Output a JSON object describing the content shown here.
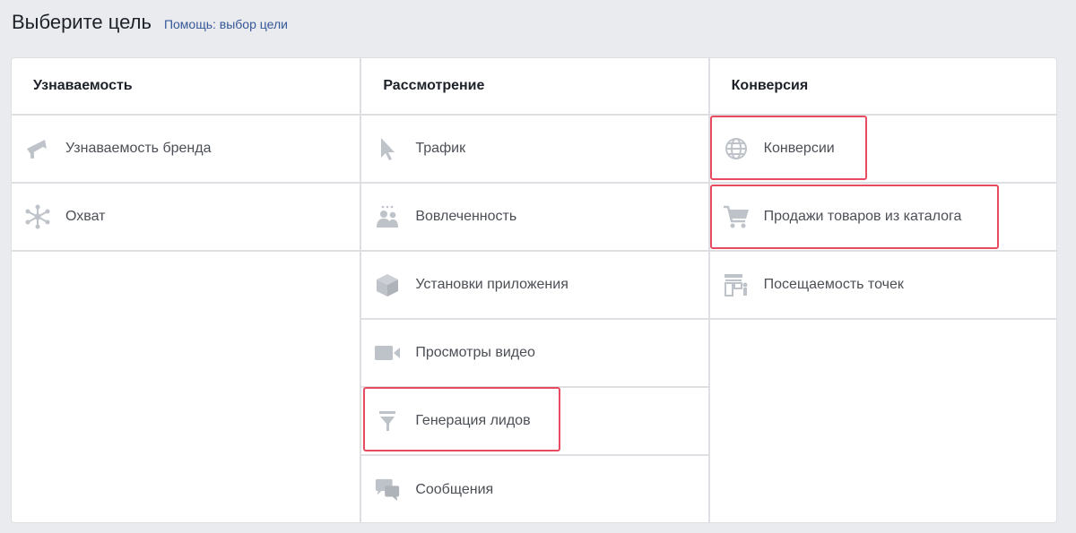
{
  "header": {
    "title": "Выберите цель",
    "help_link": "Помощь: выбор цели"
  },
  "columns": [
    {
      "title": "Узнаваемость",
      "items": [
        {
          "label": "Узнаваемость бренда",
          "icon": "megaphone-icon"
        },
        {
          "label": "Охват",
          "icon": "reach-icon"
        }
      ]
    },
    {
      "title": "Рассмотрение",
      "items": [
        {
          "label": "Трафик",
          "icon": "cursor-icon"
        },
        {
          "label": "Вовлеченность",
          "icon": "people-icon"
        },
        {
          "label": "Установки приложения",
          "icon": "box-icon"
        },
        {
          "label": "Просмотры видео",
          "icon": "video-camera-icon"
        },
        {
          "label": "Генерация лидов",
          "icon": "funnel-icon"
        },
        {
          "label": "Сообщения",
          "icon": "chat-bubbles-icon"
        }
      ]
    },
    {
      "title": "Конверсия",
      "items": [
        {
          "label": "Конверсии",
          "icon": "globe-icon"
        },
        {
          "label": "Продажи товаров из каталога",
          "icon": "shopping-cart-icon"
        },
        {
          "label": "Посещаемость точек",
          "icon": "store-icon"
        }
      ]
    }
  ],
  "colors": {
    "icon": "#bec3c9",
    "highlight": "#e84a5f",
    "link": "#365899"
  }
}
